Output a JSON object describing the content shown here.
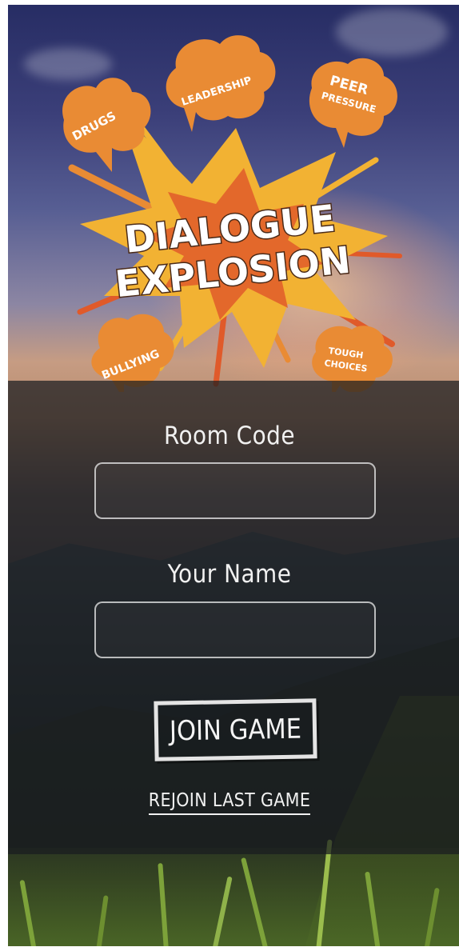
{
  "logo": {
    "title_line1": "DIALOGUE",
    "title_line2": "EXPLOSION",
    "bubbles": [
      "DRUGS",
      "LEADERSHIP",
      "PEER",
      "PRESSURE",
      "BULLYING",
      "TOUGH",
      "CHOICES"
    ]
  },
  "form": {
    "room_code_label": "Room Code",
    "room_code_value": "",
    "your_name_label": "Your Name",
    "your_name_value": "",
    "join_button": "JOIN GAME",
    "rejoin_link": "REJOIN LAST GAME"
  },
  "colors": {
    "bubble_orange": "#e98b34",
    "burst_yellow": "#f2b233",
    "burst_red": "#e05a2a"
  }
}
